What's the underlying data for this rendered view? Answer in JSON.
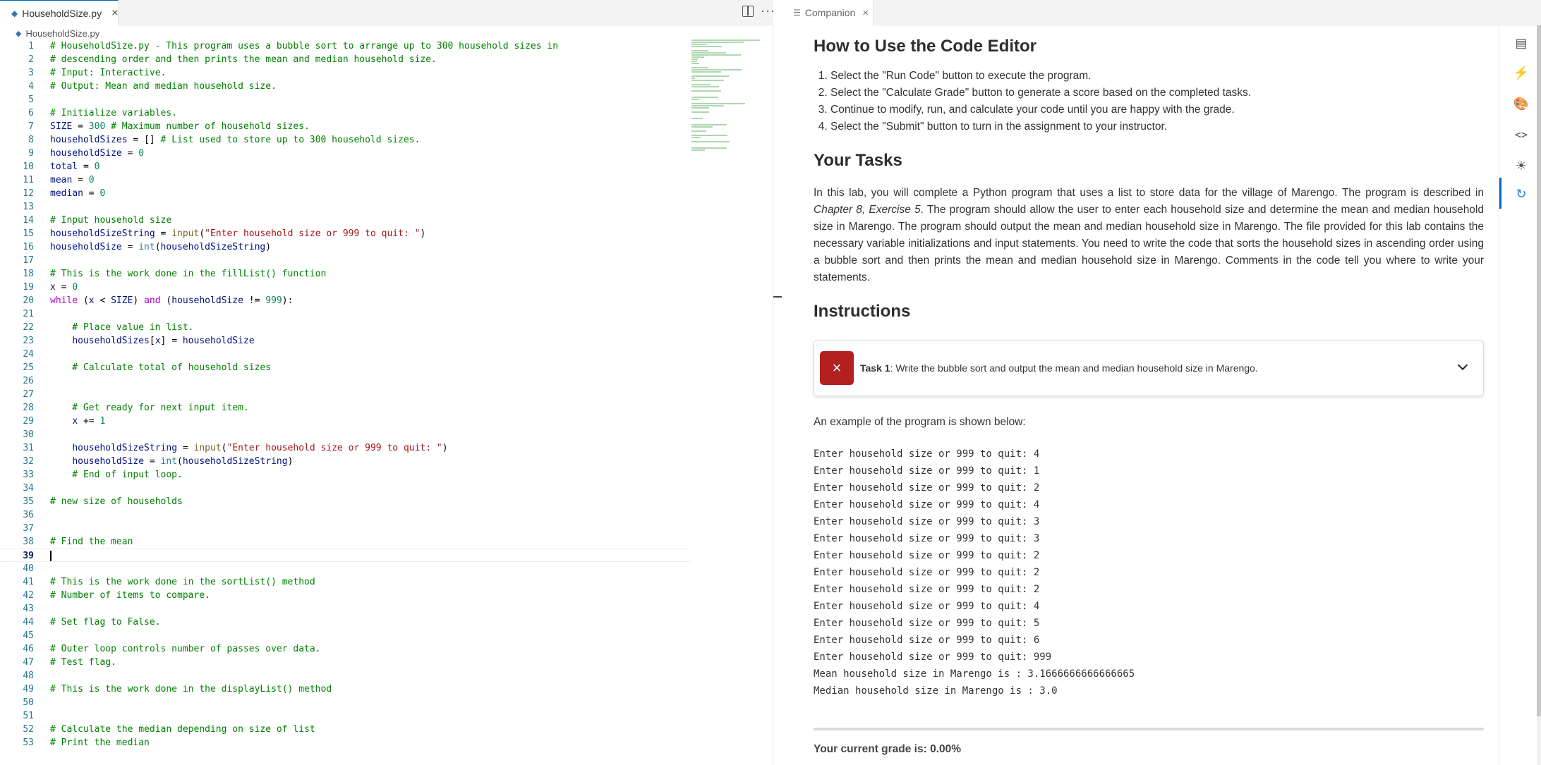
{
  "editor": {
    "tab": {
      "filename": "HouseholdSize.py",
      "close": "×"
    },
    "breadcrumb": "HouseholdSize.py",
    "more_actions": "···",
    "current_line": 39,
    "code_lines": [
      [
        {
          "t": "# HouseholdSize.py - This program uses a bubble sort to arrange up to 300 household sizes in",
          "c": "cm"
        }
      ],
      [
        {
          "t": "# descending order and then prints the mean and median household size.",
          "c": "cm"
        }
      ],
      [
        {
          "t": "# Input: Interactive.",
          "c": "cm"
        }
      ],
      [
        {
          "t": "# Output: Mean and median household size.",
          "c": "cm"
        }
      ],
      [],
      [
        {
          "t": "# Initialize variables.",
          "c": "cm"
        }
      ],
      [
        {
          "t": "SIZE",
          "c": "vr"
        },
        {
          "t": " = "
        },
        {
          "t": "300",
          "c": "nm"
        },
        {
          "t": " # Maximum number of household sizes.",
          "c": "cm"
        }
      ],
      [
        {
          "t": "householdSizes",
          "c": "vr"
        },
        {
          "t": " = "
        },
        {
          "t": "[]"
        },
        {
          "t": " # List used to store up to 300 household sizes.",
          "c": "cm"
        }
      ],
      [
        {
          "t": "householdSize",
          "c": "vr"
        },
        {
          "t": " = "
        },
        {
          "t": "0",
          "c": "nm"
        }
      ],
      [
        {
          "t": "total",
          "c": "vr"
        },
        {
          "t": " = "
        },
        {
          "t": "0",
          "c": "nm"
        }
      ],
      [
        {
          "t": "mean",
          "c": "vr"
        },
        {
          "t": " = "
        },
        {
          "t": "0",
          "c": "nm"
        }
      ],
      [
        {
          "t": "median",
          "c": "vr"
        },
        {
          "t": " = "
        },
        {
          "t": "0",
          "c": "nm"
        }
      ],
      [],
      [
        {
          "t": "# Input household size",
          "c": "cm"
        }
      ],
      [
        {
          "t": "householdSizeString",
          "c": "vr"
        },
        {
          "t": " = "
        },
        {
          "t": "input",
          "c": "fn"
        },
        {
          "t": "("
        },
        {
          "t": "\"Enter household size or 999 to quit: \"",
          "c": "st"
        },
        {
          "t": ")"
        }
      ],
      [
        {
          "t": "householdSize",
          "c": "vr"
        },
        {
          "t": " = "
        },
        {
          "t": "int",
          "c": "bi"
        },
        {
          "t": "("
        },
        {
          "t": "householdSizeString",
          "c": "vr"
        },
        {
          "t": ")"
        }
      ],
      [],
      [
        {
          "t": "# This is the work done in the fillList() function",
          "c": "cm"
        }
      ],
      [
        {
          "t": "x",
          "c": "vr"
        },
        {
          "t": " = "
        },
        {
          "t": "0",
          "c": "nm"
        }
      ],
      [
        {
          "t": "while",
          "c": "kw"
        },
        {
          "t": " ("
        },
        {
          "t": "x",
          "c": "vr"
        },
        {
          "t": " < "
        },
        {
          "t": "SIZE",
          "c": "vr"
        },
        {
          "t": ") "
        },
        {
          "t": "and",
          "c": "kw"
        },
        {
          "t": " ("
        },
        {
          "t": "householdSize",
          "c": "vr"
        },
        {
          "t": " != "
        },
        {
          "t": "999",
          "c": "nm"
        },
        {
          "t": "):"
        }
      ],
      [],
      [
        {
          "t": "    # Place value in list.",
          "c": "cm"
        }
      ],
      [
        {
          "t": "    "
        },
        {
          "t": "householdSizes",
          "c": "vr"
        },
        {
          "t": "["
        },
        {
          "t": "x",
          "c": "vr"
        },
        {
          "t": "] = "
        },
        {
          "t": "householdSize",
          "c": "vr"
        }
      ],
      [],
      [
        {
          "t": "    # Calculate total of household sizes",
          "c": "cm"
        }
      ],
      [],
      [],
      [
        {
          "t": "    # Get ready for next input item.",
          "c": "cm"
        }
      ],
      [
        {
          "t": "    "
        },
        {
          "t": "x",
          "c": "vr"
        },
        {
          "t": " += "
        },
        {
          "t": "1",
          "c": "nm"
        }
      ],
      [],
      [
        {
          "t": "    "
        },
        {
          "t": "householdSizeString",
          "c": "vr"
        },
        {
          "t": " = "
        },
        {
          "t": "input",
          "c": "fn"
        },
        {
          "t": "("
        },
        {
          "t": "\"Enter household size or 999 to quit: \"",
          "c": "st"
        },
        {
          "t": ")"
        }
      ],
      [
        {
          "t": "    "
        },
        {
          "t": "householdSize",
          "c": "vr"
        },
        {
          "t": " = "
        },
        {
          "t": "int",
          "c": "bi"
        },
        {
          "t": "("
        },
        {
          "t": "householdSizeString",
          "c": "vr"
        },
        {
          "t": ")"
        }
      ],
      [
        {
          "t": "    # End of input loop.",
          "c": "cm"
        }
      ],
      [],
      [
        {
          "t": "# new size of households",
          "c": "cm"
        }
      ],
      [],
      [],
      [
        {
          "t": "# Find the mean",
          "c": "cm"
        }
      ],
      [],
      [],
      [
        {
          "t": "# This is the work done in the sortList() method",
          "c": "cm"
        }
      ],
      [
        {
          "t": "# Number of items to compare.",
          "c": "cm"
        }
      ],
      [],
      [
        {
          "t": "# Set flag to False.",
          "c": "cm"
        }
      ],
      [],
      [
        {
          "t": "# Outer loop controls number of passes over data.",
          "c": "cm"
        }
      ],
      [
        {
          "t": "# Test flag.",
          "c": "cm"
        }
      ],
      [],
      [
        {
          "t": "# This is the work done in the displayList() method",
          "c": "cm"
        }
      ],
      [],
      [],
      [
        {
          "t": "# Calculate the median depending on size of list",
          "c": "cm"
        }
      ],
      [
        {
          "t": "# Print the median",
          "c": "cm"
        }
      ]
    ]
  },
  "companion": {
    "tab": {
      "label": "Companion",
      "close": "×"
    },
    "how_to": {
      "title": "How to Use the Code Editor",
      "steps": [
        "Select the \"Run Code\" button to execute the program.",
        "Select the \"Calculate Grade\" button to generate a score based on the completed tasks.",
        "Continue to modify, run, and calculate your code until you are happy with the grade.",
        "Select the \"Submit\" button to turn in the assignment to your instructor."
      ]
    },
    "tasks": {
      "title": "Your Tasks",
      "para_before": "In this lab, you will complete a Python program that uses a list to store data for the village of Marengo. The program is described in ",
      "para_em": "Chapter 8, Exercise 5",
      "para_after": ". The program should allow the user to enter each household size and determine the mean and median household size in Marengo. The program should output the mean and median household size in Marengo. The file provided for this lab contains the necessary variable initializations and input statements. You need to write the code that sorts the household sizes in ascending order using a bubble sort and then prints the mean and median household size in Marengo. Comments in the code tell you where to write your statements."
    },
    "instructions": {
      "title": "Instructions",
      "task1_label": "Task 1",
      "task1_text": ": Write the bubble sort and output the mean and median household size in Marengo.",
      "task1_status": "×"
    },
    "example": {
      "intro": "An example of the program is shown below:",
      "lines": [
        "Enter household size or 999 to quit: 4",
        "Enter household size or 999 to quit: 1",
        "Enter household size or 999 to quit: 2",
        "Enter household size or 999 to quit: 4",
        "Enter household size or 999 to quit: 3",
        "Enter household size or 999 to quit: 3",
        "Enter household size or 999 to quit: 2",
        "Enter household size or 999 to quit: 2",
        "Enter household size or 999 to quit: 2",
        "Enter household size or 999 to quit: 4",
        "Enter household size or 999 to quit: 5",
        "Enter household size or 999 to quit: 6",
        "Enter household size or 999 to quit: 999",
        "Mean household size in Marengo is : 3.1666666666666665",
        "Median household size in Marengo is : 3.0"
      ]
    },
    "grade": {
      "label": "Your current grade is: ",
      "value": "0.00%"
    }
  },
  "activity_bar": {
    "icons": [
      "document-icon",
      "lightning-icon",
      "palette-icon",
      "code-icon",
      "theme-icon",
      "refresh-icon"
    ],
    "active_index": 5
  },
  "colors": {
    "comment": "#008000",
    "string": "#a31515",
    "number": "#098658",
    "keyword": "#af00db",
    "line_number": "#237893",
    "fail_badge": "#b22020",
    "accent": "#0066b8"
  }
}
